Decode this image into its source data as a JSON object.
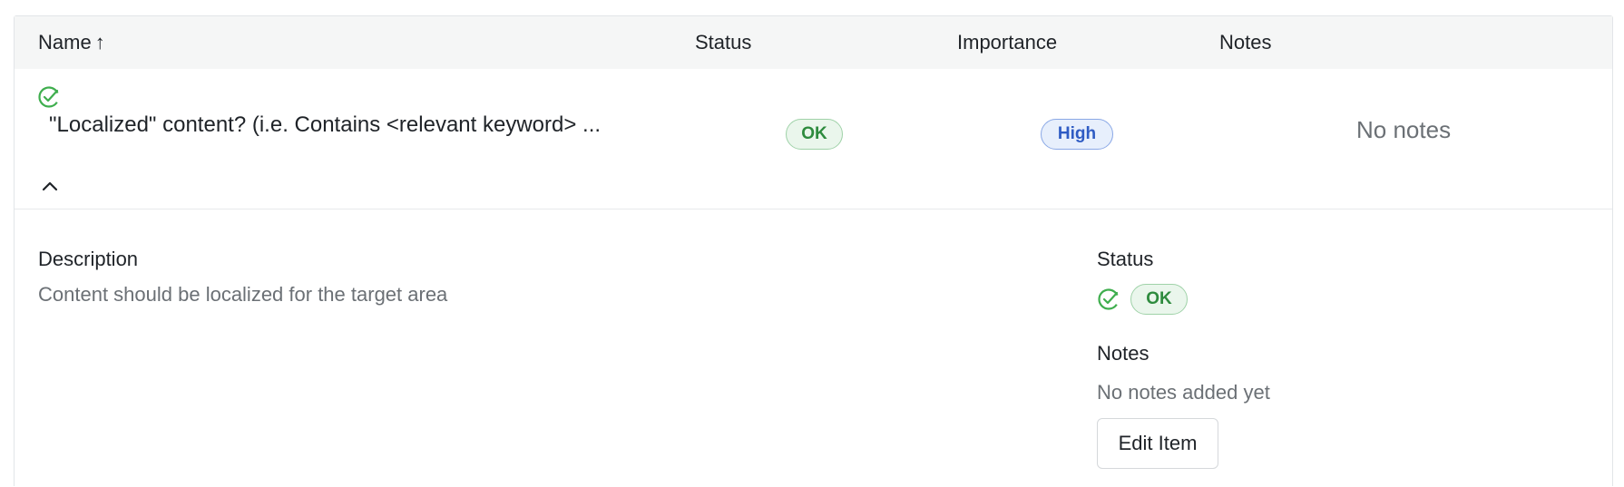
{
  "table": {
    "headers": {
      "name": "Name",
      "sort_arrow": "↑",
      "status": "Status",
      "importance": "Importance",
      "notes": "Notes"
    },
    "row": {
      "name": "\"Localized\" content? (i.e. Contains <relevant keyword> ...",
      "status_badge": "OK",
      "importance_badge": "High",
      "notes": "No notes",
      "status_icon": "check-circle-icon",
      "collapse_icon": "chevron-up-icon"
    },
    "detail": {
      "description_label": "Description",
      "description_value": "Content should be localized for the target area",
      "status_label": "Status",
      "status_badge": "OK",
      "notes_label": "Notes",
      "notes_value": "No notes added yet",
      "edit_button": "Edit Item"
    }
  },
  "colors": {
    "ok_green": "#2e8b3e",
    "ok_bg": "#eaf6ec",
    "high_blue": "#2f5cc4",
    "high_bg": "#e7effc",
    "header_bg": "#f5f6f6",
    "muted_text": "#6b7075"
  }
}
